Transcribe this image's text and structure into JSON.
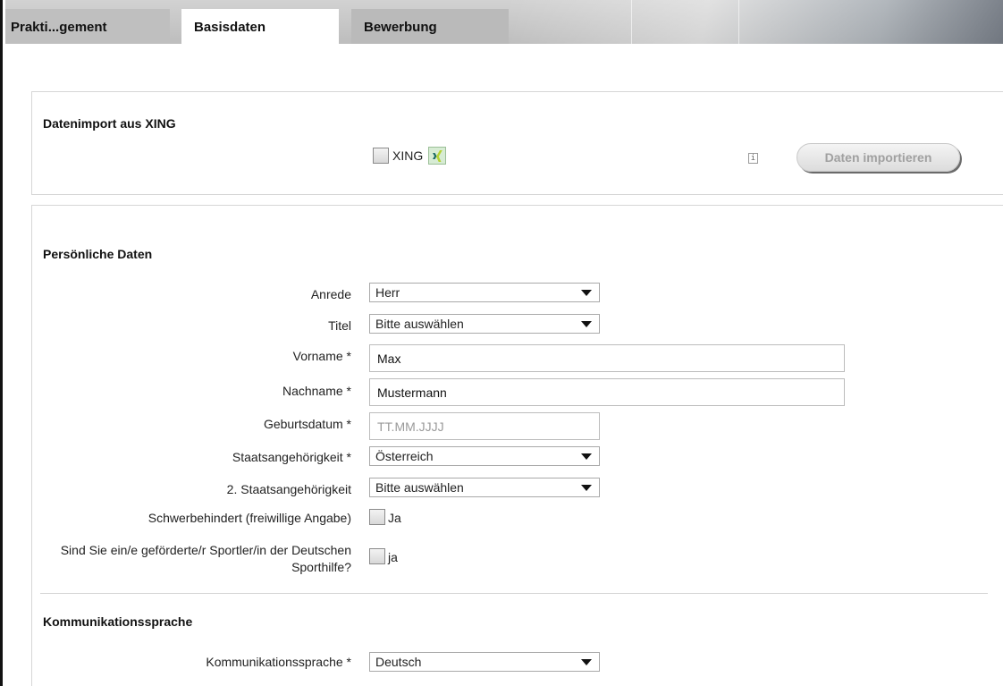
{
  "tabs": [
    {
      "label": "Prakti...gement"
    },
    {
      "label": "Basisdaten"
    },
    {
      "label": "Bewerbung"
    }
  ],
  "xing": {
    "section_title": "Datenimport aus XING",
    "checkbox_label": "XING",
    "checked": false,
    "info_glyph": "i",
    "import_button": "Daten importieren"
  },
  "personal": {
    "section_title": "Persönliche Daten",
    "anrede": {
      "label": "Anrede",
      "value": "Herr"
    },
    "titel": {
      "label": "Titel",
      "value": "Bitte auswählen"
    },
    "vorname": {
      "label": "Vorname *",
      "value": "Max"
    },
    "nachname": {
      "label": "Nachname *",
      "value": "Mustermann"
    },
    "geburtsdatum": {
      "label": "Geburtsdatum *",
      "value": "",
      "placeholder": "TT.MM.JJJJ"
    },
    "staat": {
      "label": "Staatsangehörigkeit *",
      "value": "Österreich"
    },
    "staat2": {
      "label": "2. Staatsangehörigkeit",
      "value": "Bitte auswählen"
    },
    "schwerbehindert": {
      "label": "Schwerbehindert (freiwillige Angabe)",
      "option": "Ja",
      "checked": false
    },
    "sporthilfe": {
      "label": "Sind Sie ein/e geförderte/r Sportler/in der Deutschen Sporthilfe?",
      "option": "ja",
      "checked": false
    }
  },
  "communication": {
    "section_title": "Kommunikationssprache",
    "sprache": {
      "label": "Kommunikationssprache *",
      "value": "Deutsch"
    }
  }
}
